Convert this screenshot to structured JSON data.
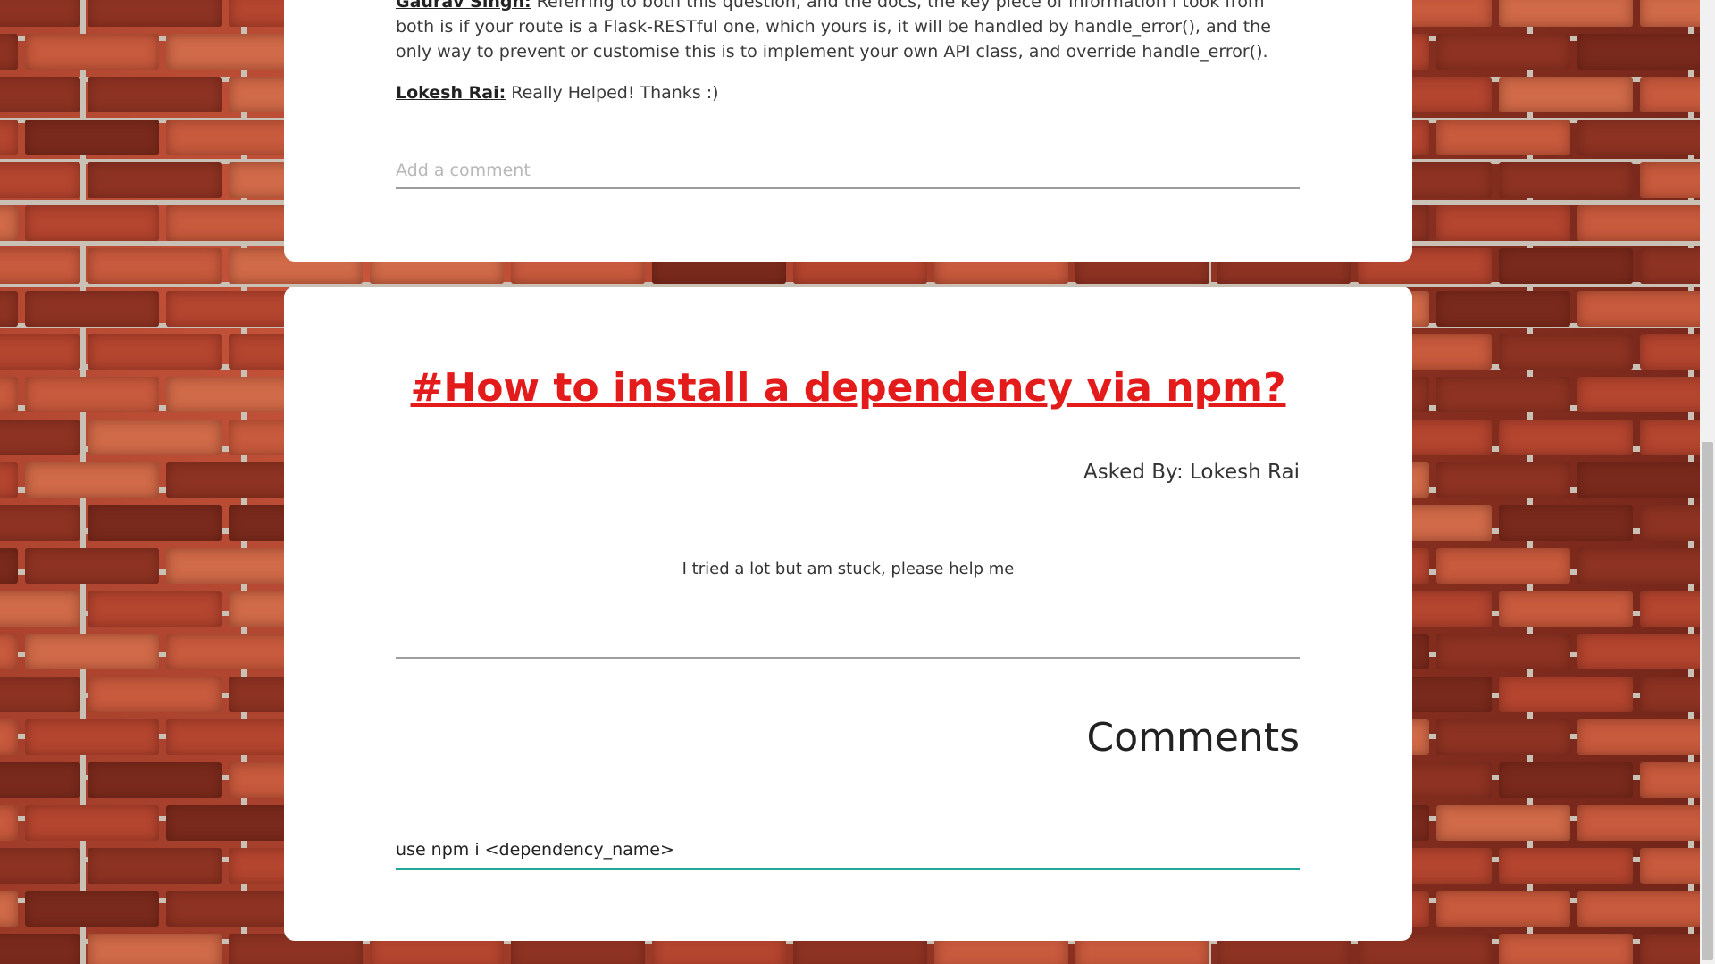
{
  "previous_post": {
    "comments": [
      {
        "author": "Gaurav Singh:",
        "text": "Referring to both this question, and the docs, the key piece of information I took from both is if your route is a Flask-RESTful one, which yours is, it will be handled by handle_error(), and the only way to prevent or customise this is to implement your own API class, and override handle_error()."
      },
      {
        "author": "Lokesh Rai:",
        "text": "Really Helped! Thanks :)"
      }
    ],
    "add_comment_placeholder": "Add a comment"
  },
  "question": {
    "title": "#How to install a dependency via npm?",
    "asked_by": "Asked By: Lokesh Rai",
    "body": "I tried a lot but am stuck, please help me"
  },
  "comments_section": {
    "heading": "Comments",
    "input_value": "use npm i <dependency_name> "
  },
  "colors": {
    "title_red": "#e31b1b",
    "input_focus_teal": "#26a69a"
  }
}
